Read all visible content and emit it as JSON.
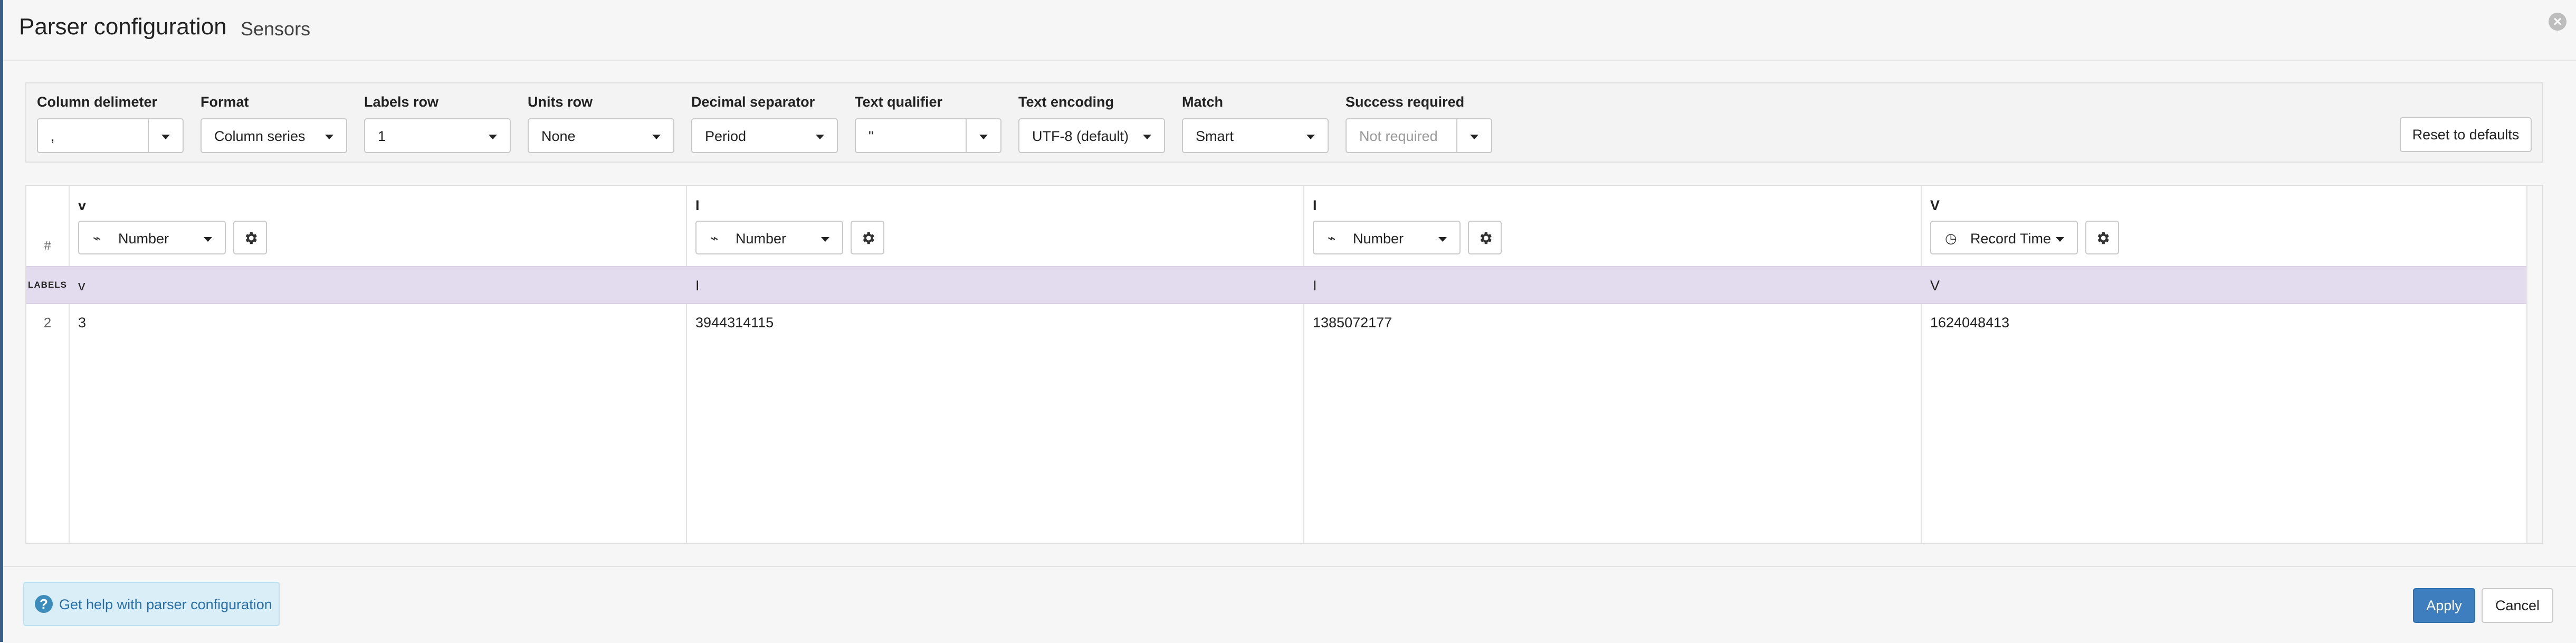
{
  "header": {
    "title": "Parser configuration",
    "subtitle": "Sensors",
    "close_icon": "close-icon"
  },
  "options": {
    "column_delimiter": {
      "label": "Column delimeter",
      "value": ","
    },
    "format": {
      "label": "Format",
      "value": "Column series"
    },
    "labels_row": {
      "label": "Labels row",
      "value": "1"
    },
    "units_row": {
      "label": "Units row",
      "value": "None"
    },
    "decimal_separator": {
      "label": "Decimal separator",
      "value": "Period"
    },
    "text_qualifier": {
      "label": "Text qualifier",
      "value": "\""
    },
    "text_encoding": {
      "label": "Text encoding",
      "value": "UTF-8 (default)"
    },
    "match": {
      "label": "Match",
      "value": "Smart"
    },
    "success_required": {
      "label": "Success required",
      "placeholder": "Not required"
    },
    "reset_label": "Reset to defaults"
  },
  "table": {
    "hash_header": "#",
    "labels_tag": "LABELS",
    "columns": [
      {
        "name": "v",
        "type": "Number",
        "icon": "waveform-icon",
        "label": "v",
        "row2": "3"
      },
      {
        "name": "I",
        "type": "Number",
        "icon": "waveform-icon",
        "label": "I",
        "row2": "3944314115"
      },
      {
        "name": "I",
        "type": "Number",
        "icon": "waveform-icon",
        "label": "I",
        "row2": "1385072177"
      },
      {
        "name": "V",
        "type": "Record Time",
        "icon": "clock-icon",
        "label": "V",
        "row2": "1624048413"
      }
    ],
    "row_numbers": [
      "2"
    ]
  },
  "footer": {
    "help_label": "Get help with parser configuration",
    "apply_label": "Apply",
    "cancel_label": "Cancel"
  },
  "colors": {
    "labels_row_bg": "#e3dbee",
    "primary_button": "#3e7ebf",
    "help_bg": "#d9eef7"
  }
}
